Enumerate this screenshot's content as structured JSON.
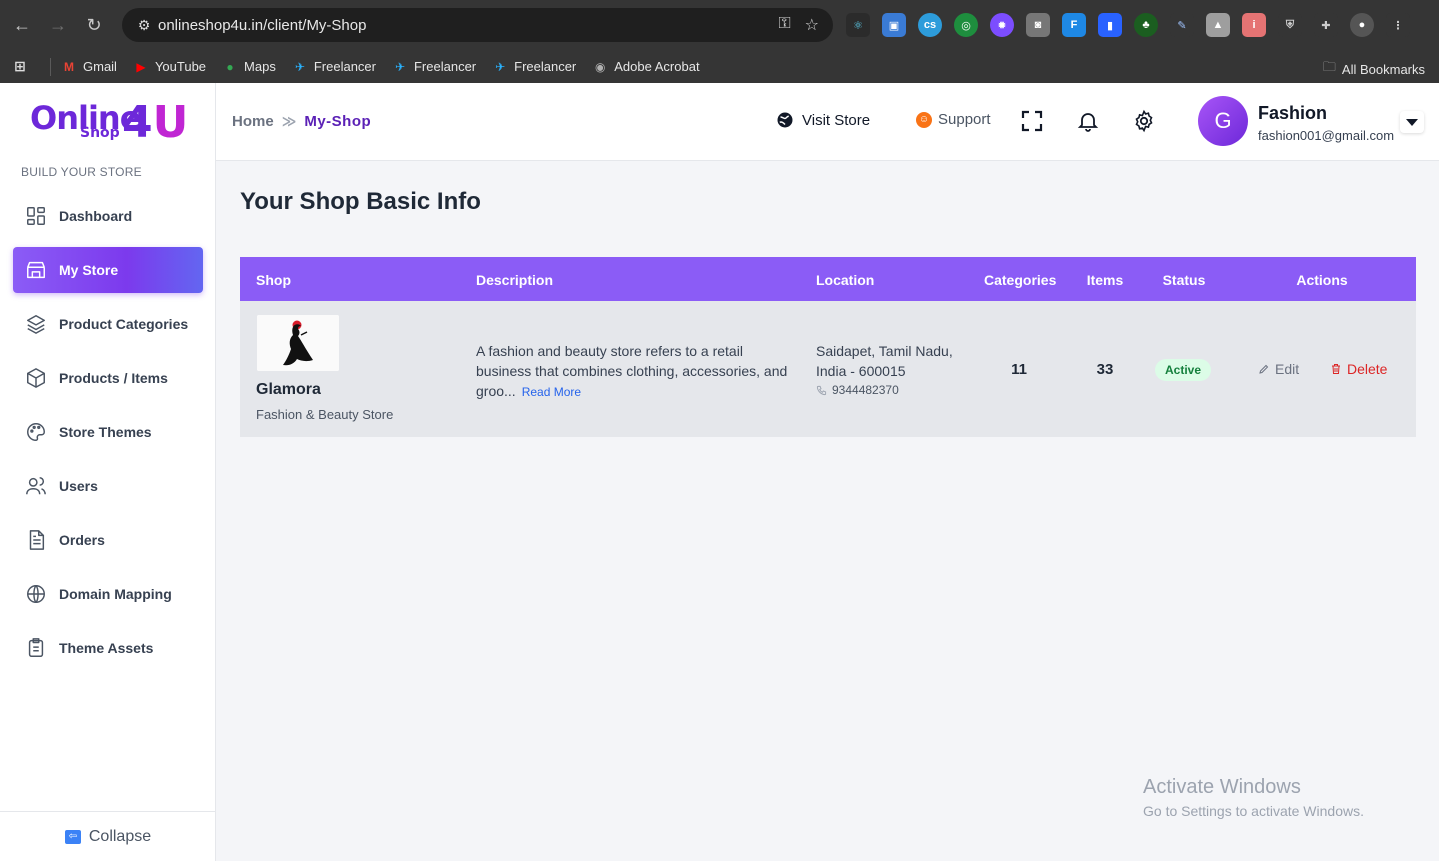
{
  "browser": {
    "url": "onlineshop4u.in/client/My-Shop",
    "bookmarks": [
      {
        "label": "Gmail",
        "color": "#ea4335",
        "glyph": "M"
      },
      {
        "label": "YouTube",
        "color": "#ff0000",
        "glyph": "▶"
      },
      {
        "label": "Maps",
        "color": "#34a853",
        "glyph": "●"
      },
      {
        "label": "Freelancer",
        "color": "#29b2fe",
        "glyph": "✈"
      },
      {
        "label": "Freelancer",
        "color": "#29b2fe",
        "glyph": "✈"
      },
      {
        "label": "Freelancer",
        "color": "#29b2fe",
        "glyph": "✈"
      },
      {
        "label": "Adobe Acrobat",
        "color": "#b0b0b0",
        "glyph": "◉"
      }
    ],
    "all_bookmarks": "All Bookmarks"
  },
  "sidebar": {
    "logo_online": "Online",
    "logo_shop": "Shop",
    "logo_four": "4",
    "logo_u": "U",
    "section_label": "BUILD YOUR STORE",
    "items": [
      {
        "label": "Dashboard",
        "icon": "dashboard-icon"
      },
      {
        "label": "My Store",
        "icon": "store-icon",
        "active": true
      },
      {
        "label": "Product Categories",
        "icon": "layers-icon"
      },
      {
        "label": "Products / Items",
        "icon": "box-icon"
      },
      {
        "label": "Store Themes",
        "icon": "palette-icon"
      },
      {
        "label": "Users",
        "icon": "users-icon"
      },
      {
        "label": "Orders",
        "icon": "document-icon"
      },
      {
        "label": "Domain Mapping",
        "icon": "globe-icon"
      },
      {
        "label": "Theme Assets",
        "icon": "clipboard-icon"
      }
    ],
    "collapse_label": "Collapse"
  },
  "header": {
    "breadcrumb_home": "Home",
    "breadcrumb_sep": "≫",
    "breadcrumb_current": "My-Shop",
    "visit_store": "Visit Store",
    "support": "Support",
    "user_initial": "G",
    "user_name": "Fashion",
    "user_email": "fashion001@gmail.com"
  },
  "main": {
    "title": "Your Shop Basic Info",
    "table": {
      "headers": {
        "shop": "Shop",
        "description": "Description",
        "location": "Location",
        "categories": "Categories",
        "items": "Items",
        "status": "Status",
        "actions": "Actions"
      },
      "row": {
        "shop_name": "Glamora",
        "shop_sub": "Fashion & Beauty Store",
        "description": "A fashion and beauty store refers to a retail business that combines clothing, accessories, and groo...",
        "read_more": "Read More",
        "location": "Saidapet, Tamil Nadu, India - 600015",
        "phone": "9344482370",
        "categories": "11",
        "items": "33",
        "status": "Active",
        "edit": "Edit",
        "delete": "Delete"
      }
    }
  },
  "watermark": {
    "line1": "Activate Windows",
    "line2": "Go to Settings to activate Windows."
  }
}
